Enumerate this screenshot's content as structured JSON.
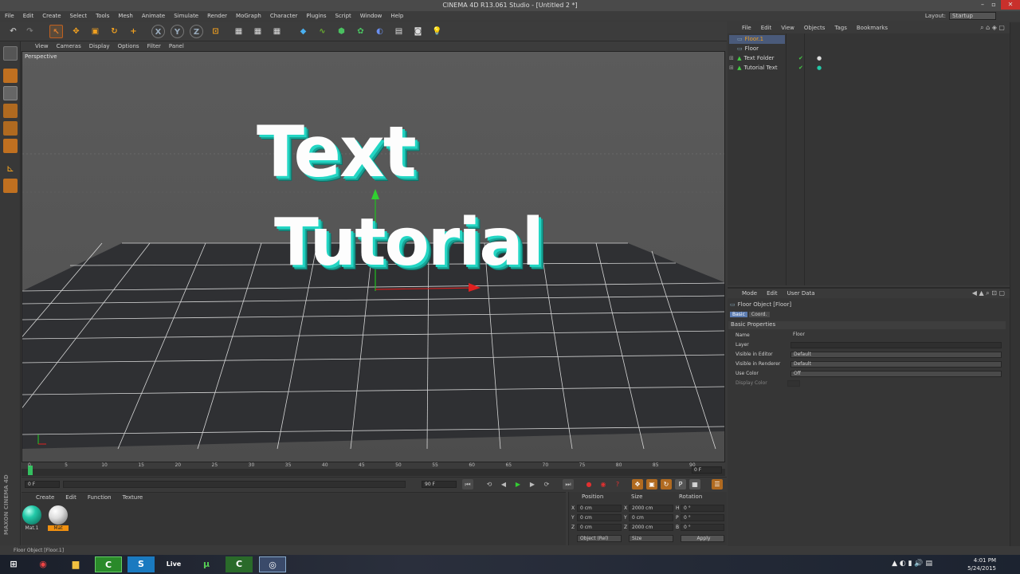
{
  "window": {
    "title": "CINEMA 4D R13.061 Studio - [Untitled 2 *]",
    "menu": [
      "File",
      "Edit",
      "Create",
      "Select",
      "Tools",
      "Mesh",
      "Animate",
      "Simulate",
      "Render",
      "MoGraph",
      "Character",
      "Plugins",
      "Script",
      "Window",
      "Help"
    ],
    "layout_label": "Layout:",
    "layout_value": "Startup"
  },
  "viewport": {
    "menu": [
      "View",
      "Cameras",
      "Display",
      "Options",
      "Filter",
      "Panel"
    ],
    "camera_label": "Perspective",
    "text_line1": "Text",
    "text_line2": "Tutorial"
  },
  "timeline": {
    "ticks": [
      "0",
      "5",
      "10",
      "15",
      "20",
      "25",
      "30",
      "35",
      "40",
      "45",
      "50",
      "55",
      "60",
      "65",
      "70",
      "75",
      "80",
      "85",
      "90"
    ],
    "current_frame": "0 F",
    "start_frame": "0 F",
    "end_frame": "90 F"
  },
  "materials": {
    "menu": [
      "Create",
      "Edit",
      "Function",
      "Texture"
    ],
    "items": [
      {
        "name": "Mat.1",
        "color": "#22c9a8"
      },
      {
        "name": "Mat",
        "color": "#e8e8e8"
      }
    ],
    "brand": "MAXON CINEMA 4D"
  },
  "coordinates": {
    "headers": [
      "Position",
      "Size",
      "Rotation"
    ],
    "rows": [
      {
        "axis": "X",
        "pos": "0 cm",
        "size_axis": "X",
        "size": "2000 cm",
        "rot_axis": "H",
        "rot": "0 °"
      },
      {
        "axis": "Y",
        "pos": "0 cm",
        "size_axis": "Y",
        "size": "0 cm",
        "rot_axis": "P",
        "rot": "0 °"
      },
      {
        "axis": "Z",
        "pos": "0 cm",
        "size_axis": "Z",
        "size": "2000 cm",
        "rot_axis": "B",
        "rot": "0 °"
      }
    ],
    "mode_select": "Object (Rel)",
    "size_select": "Size",
    "apply_label": "Apply"
  },
  "object_manager": {
    "menu": [
      "File",
      "Edit",
      "View",
      "Objects",
      "Tags",
      "Bookmarks"
    ],
    "objects": [
      {
        "name": "Floor.1"
      },
      {
        "name": "Floor"
      },
      {
        "name": "Text Folder"
      },
      {
        "name": "Tutorial Text"
      }
    ]
  },
  "attributes": {
    "menu": [
      "Mode",
      "Edit",
      "User Data"
    ],
    "object_title": "Floor Object [Floor]",
    "tabs": [
      "Basic",
      "Coord."
    ],
    "section": "Basic Properties",
    "fields": [
      {
        "label": "Name",
        "value": "Floor"
      },
      {
        "label": "Layer",
        "value": ""
      },
      {
        "label": "Visible in Editor",
        "value": "Default"
      },
      {
        "label": "Visible in Renderer",
        "value": "Default"
      },
      {
        "label": "Use Color",
        "value": "Off"
      },
      {
        "label": "Display Color",
        "value": ""
      }
    ]
  },
  "status_bar": "Floor Object [Floor.1]",
  "taskbar": {
    "apps": [
      "windows-start",
      "chrome",
      "file-explorer",
      "camtasia",
      "skype",
      "live",
      "utorrent",
      "camtasia-2",
      "cinema4d"
    ],
    "live_label": "Live",
    "time": "4:01 PM",
    "date": "5/24/2015"
  }
}
